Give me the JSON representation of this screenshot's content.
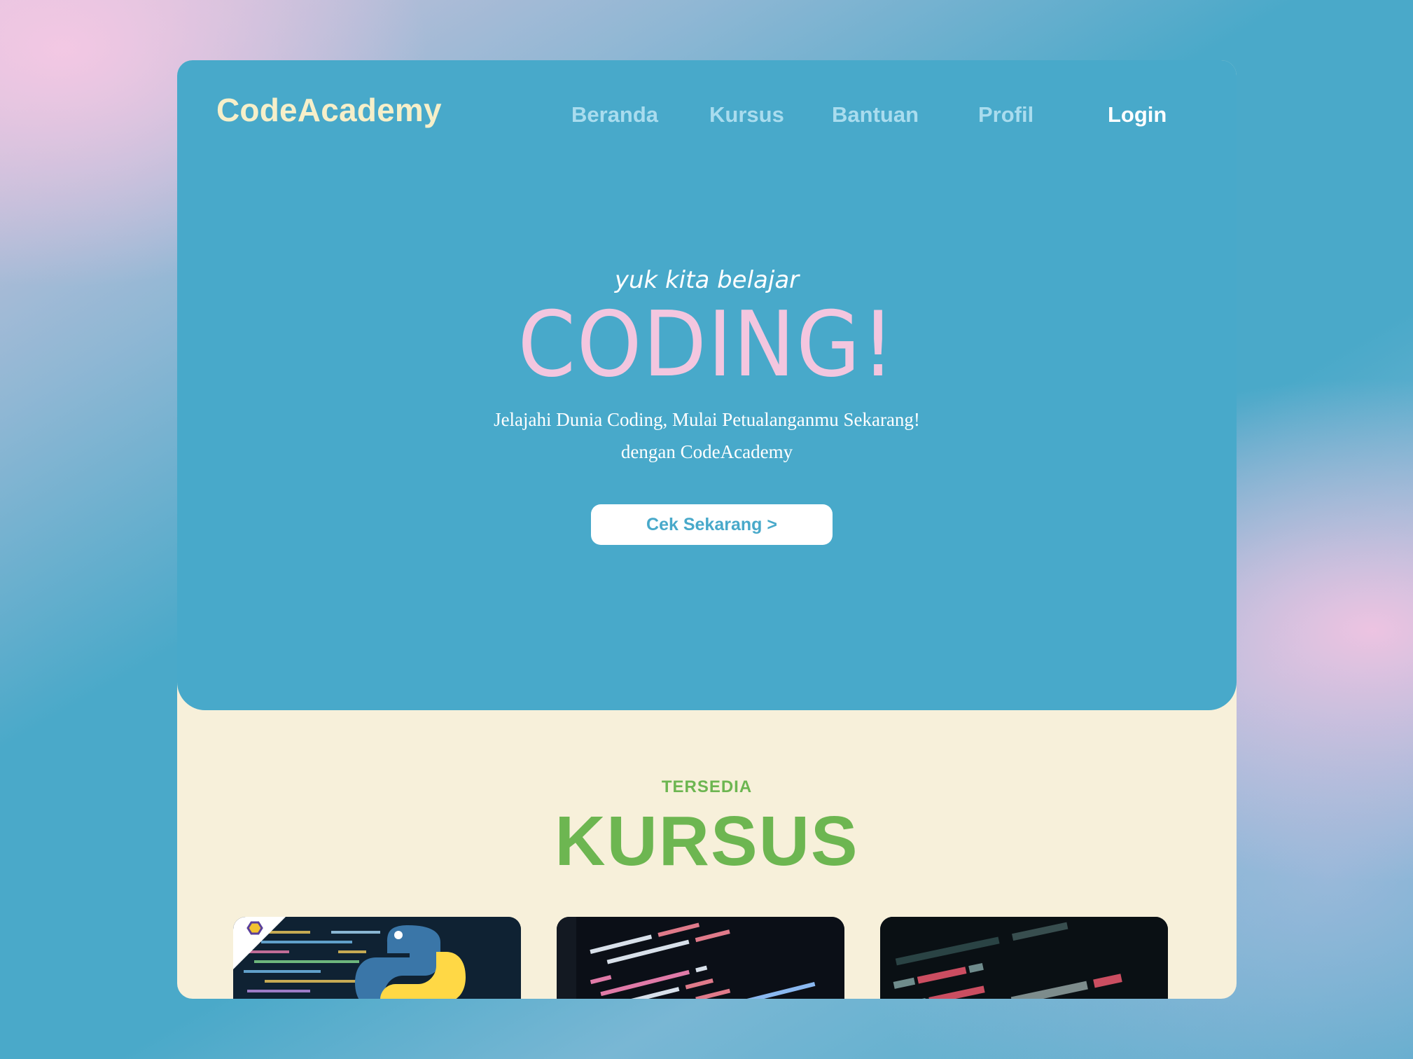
{
  "brand": {
    "name": "CodeAcademy"
  },
  "nav": {
    "items": [
      "Beranda",
      "Kursus",
      "Bantuan",
      "Profil"
    ],
    "login": "Login"
  },
  "hero": {
    "kicker": "yuk kita belajar",
    "headline": "CODING!",
    "subtitle_line1": "Jelajahi Dunia Coding, Mulai Petualanganmu Sekarang!",
    "subtitle_line2": "dengan CodeAcademy",
    "cta": "Cek Sekarang >"
  },
  "courses": {
    "kicker": "TERSEDIA",
    "title": "KURSUS",
    "cards": [
      {
        "icon": "python-logo",
        "code_snippet": ""
      },
      {
        "icon": "css-code",
        "code_snippet": ""
      },
      {
        "icon": "html-code",
        "code_snippet": ""
      }
    ]
  },
  "colors": {
    "hero_bg": "#48a9ca",
    "logo": "#f6efc9",
    "nav": "#a9dcee",
    "headline": "#f3c6df",
    "section_bg": "#f7f0da",
    "green": "#6db651"
  }
}
